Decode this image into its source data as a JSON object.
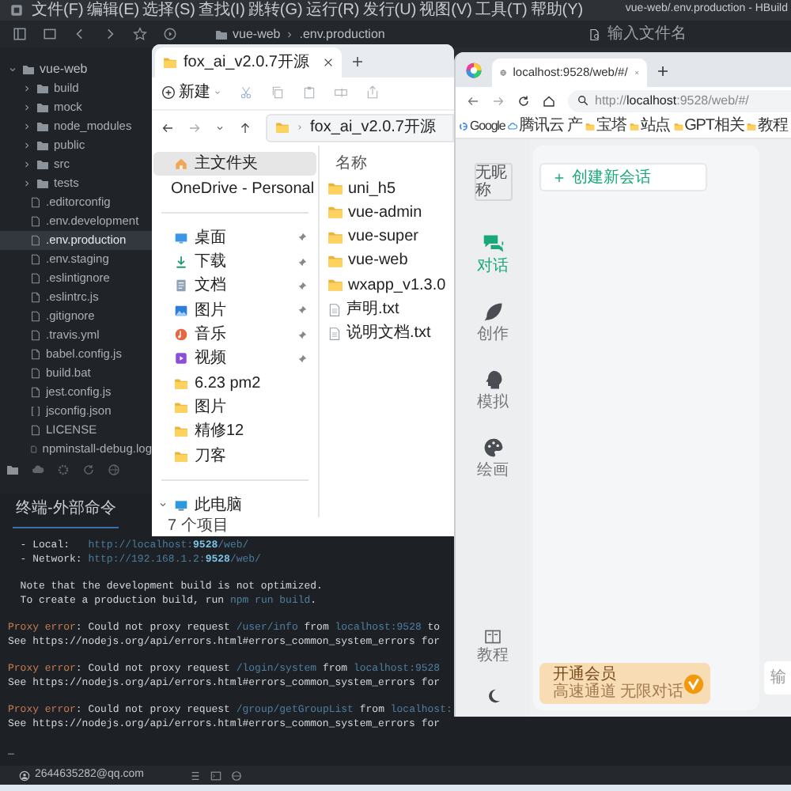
{
  "menu": [
    "文件(F)",
    "编辑(E)",
    "选择(S)",
    "查找(I)",
    "跳转(G)",
    "运行(R)",
    "发行(U)",
    "视图(V)",
    "工具(T)",
    "帮助(Y)"
  ],
  "window_title": "vue-web/.env.production - HBuild",
  "breadcrumb": [
    "vue-web",
    ".env.production"
  ],
  "file_search": {
    "placeholder": "输入文件名"
  },
  "project_tree": {
    "label": "vue-web",
    "expanded": true,
    "children": [
      {
        "label": "build",
        "kind": "folder",
        "expanded": false,
        "selected": false
      },
      {
        "label": "mock",
        "kind": "folder",
        "expanded": false,
        "selected": false
      },
      {
        "label": "node_modules",
        "kind": "folder",
        "expanded": false,
        "selected": false
      },
      {
        "label": "public",
        "kind": "folder",
        "expanded": false,
        "selected": false
      },
      {
        "label": "src",
        "kind": "folder",
        "expanded": false,
        "selected": false
      },
      {
        "label": "tests",
        "kind": "folder",
        "expanded": false,
        "selected": false
      },
      {
        "label": ".editorconfig",
        "kind": "file",
        "selected": false
      },
      {
        "label": ".env.development",
        "kind": "file",
        "selected": false
      },
      {
        "label": ".env.production",
        "kind": "file",
        "selected": true
      },
      {
        "label": ".env.staging",
        "kind": "file",
        "selected": false
      },
      {
        "label": ".eslintignore",
        "kind": "file",
        "selected": false
      },
      {
        "label": ".eslintrc.js",
        "kind": "script",
        "selected": false
      },
      {
        "label": ".gitignore",
        "kind": "file",
        "selected": false
      },
      {
        "label": ".travis.yml",
        "kind": "file",
        "selected": false
      },
      {
        "label": "babel.config.js",
        "kind": "script",
        "selected": false
      },
      {
        "label": "build.bat",
        "kind": "file",
        "selected": false
      },
      {
        "label": "jest.config.js",
        "kind": "script",
        "selected": false
      },
      {
        "label": "jsconfig.json",
        "kind": "json",
        "selected": false
      },
      {
        "label": "LICENSE",
        "kind": "file",
        "selected": false
      },
      {
        "label": "npminstall-debug.log",
        "kind": "file",
        "selected": false
      }
    ]
  },
  "terminal": {
    "tab": "终端-外部命令",
    "blocks": [
      [
        [
          {
            "text": "  - Local:   ",
            "kind": "plain"
          },
          {
            "text": "http://localhost:",
            "kind": "link"
          },
          {
            "text": "9528",
            "kind": "port"
          },
          {
            "text": "/web/",
            "kind": "link"
          }
        ],
        [
          {
            "text": "  - Network: ",
            "kind": "plain"
          },
          {
            "text": "http://192.168.1.2:",
            "kind": "link"
          },
          {
            "text": "9528",
            "kind": "port"
          },
          {
            "text": "/web/",
            "kind": "link"
          }
        ]
      ],
      [
        [
          {
            "text": "  Note that the development build is not optimized.",
            "kind": "plain"
          }
        ],
        [
          {
            "text": "  To create a production build, run ",
            "kind": "plain"
          },
          {
            "text": "npm run build",
            "kind": "path"
          },
          {
            "text": ".",
            "kind": "plain"
          }
        ]
      ],
      [
        [
          {
            "text": "Proxy error",
            "kind": "error"
          },
          {
            "text": ": Could not proxy request ",
            "kind": "plain"
          },
          {
            "text": "/user/info",
            "kind": "path"
          },
          {
            "text": " from ",
            "kind": "plain"
          },
          {
            "text": "localhost:9528",
            "kind": "path"
          },
          {
            "text": " to",
            "kind": "plain"
          }
        ],
        [
          {
            "text": "See https://nodejs.org/api/errors.html#errors_common_system_errors for",
            "kind": "plain"
          }
        ]
      ],
      [
        [
          {
            "text": "Proxy error",
            "kind": "error"
          },
          {
            "text": ": Could not proxy request ",
            "kind": "plain"
          },
          {
            "text": "/login/system",
            "kind": "path"
          },
          {
            "text": " from ",
            "kind": "plain"
          },
          {
            "text": "localhost:9528",
            "kind": "path"
          }
        ],
        [
          {
            "text": "See https://nodejs.org/api/errors.html#errors_common_system_errors for",
            "kind": "plain"
          }
        ]
      ],
      [
        [
          {
            "text": "Proxy error",
            "kind": "error"
          },
          {
            "text": ": Could not proxy request ",
            "kind": "plain"
          },
          {
            "text": "/group/getGroupList",
            "kind": "path"
          },
          {
            "text": " from ",
            "kind": "plain"
          },
          {
            "text": "localhost:",
            "kind": "path"
          }
        ],
        [
          {
            "text": "See https://nodejs.org/api/errors.html#errors_common_system_errors for",
            "kind": "plain"
          }
        ]
      ],
      [
        [
          {
            "text": "_",
            "kind": "plain"
          }
        ]
      ]
    ]
  },
  "status_bar": {
    "account": "2644635282@qq.com"
  },
  "explorer": {
    "tab": "fox_ai_v2.0.7开源",
    "new_button": "新建",
    "path": "fox_ai_v2.0.7开源",
    "nav_sections": [
      [
        {
          "label": "主文件夹",
          "kind": "home",
          "selected": true,
          "pinned": false
        },
        {
          "label": "OneDrive - Personal",
          "kind": "cloud",
          "selected": false,
          "pinned": false,
          "expanded": false
        }
      ],
      [
        {
          "label": "桌面",
          "kind": "desktop",
          "selected": false,
          "pinned": true
        },
        {
          "label": "下载",
          "kind": "download",
          "selected": false,
          "pinned": true
        },
        {
          "label": "文档",
          "kind": "docs",
          "selected": false,
          "pinned": true
        },
        {
          "label": "图片",
          "kind": "pictures",
          "selected": false,
          "pinned": true
        },
        {
          "label": "音乐",
          "kind": "music",
          "selected": false,
          "pinned": true
        },
        {
          "label": "视频",
          "kind": "video",
          "selected": false,
          "pinned": true
        },
        {
          "label": "6.23 pm2",
          "kind": "folder",
          "selected": false,
          "pinned": false
        },
        {
          "label": "图片",
          "kind": "folder",
          "selected": false,
          "pinned": false
        },
        {
          "label": "精修12",
          "kind": "folder",
          "selected": false,
          "pinned": false
        },
        {
          "label": "刀客",
          "kind": "folder",
          "selected": false,
          "pinned": false
        }
      ],
      [
        {
          "label": "此电脑",
          "kind": "pc",
          "selected": false,
          "pinned": false,
          "expanded": true
        }
      ]
    ],
    "column": "名称",
    "files": [
      {
        "name": "uni_h5",
        "kind": "folder"
      },
      {
        "name": "vue-admin",
        "kind": "folder"
      },
      {
        "name": "vue-super",
        "kind": "folder"
      },
      {
        "name": "vue-web",
        "kind": "folder"
      },
      {
        "name": "wxapp_v1.3.0",
        "kind": "folder"
      },
      {
        "name": "声明.txt",
        "kind": "text"
      },
      {
        "name": "说明文档.txt",
        "kind": "text"
      }
    ],
    "status": "7 个项目"
  },
  "browser": {
    "tab": "localhost:9528/web/#/",
    "url": {
      "scheme": "http://",
      "host": "localhost",
      "path": ":9528/web/#/"
    },
    "bookmarks": [
      {
        "label": "Google",
        "kind": "google"
      },
      {
        "label": "腾讯云 产",
        "kind": "cloud"
      },
      {
        "label": "宝塔",
        "kind": "folder"
      },
      {
        "label": "站点",
        "kind": "folder"
      },
      {
        "label": "GPT相关",
        "kind": "folder"
      },
      {
        "label": "教程",
        "kind": "folder"
      }
    ],
    "app": {
      "avatar_alt": "无昵称",
      "nav": [
        {
          "label": "对话",
          "kind": "chat",
          "selected": true
        },
        {
          "label": "创作",
          "kind": "feather",
          "selected": false
        },
        {
          "label": "模拟",
          "kind": "head",
          "selected": false
        },
        {
          "label": "绘画",
          "kind": "palette",
          "selected": false
        }
      ],
      "tutorial": "教程",
      "new_chat": "创建新会话",
      "promo": {
        "title": "开通会员",
        "subtitle": "高速通道 无限对话"
      },
      "input": {
        "placeholder": "输"
      }
    }
  }
}
